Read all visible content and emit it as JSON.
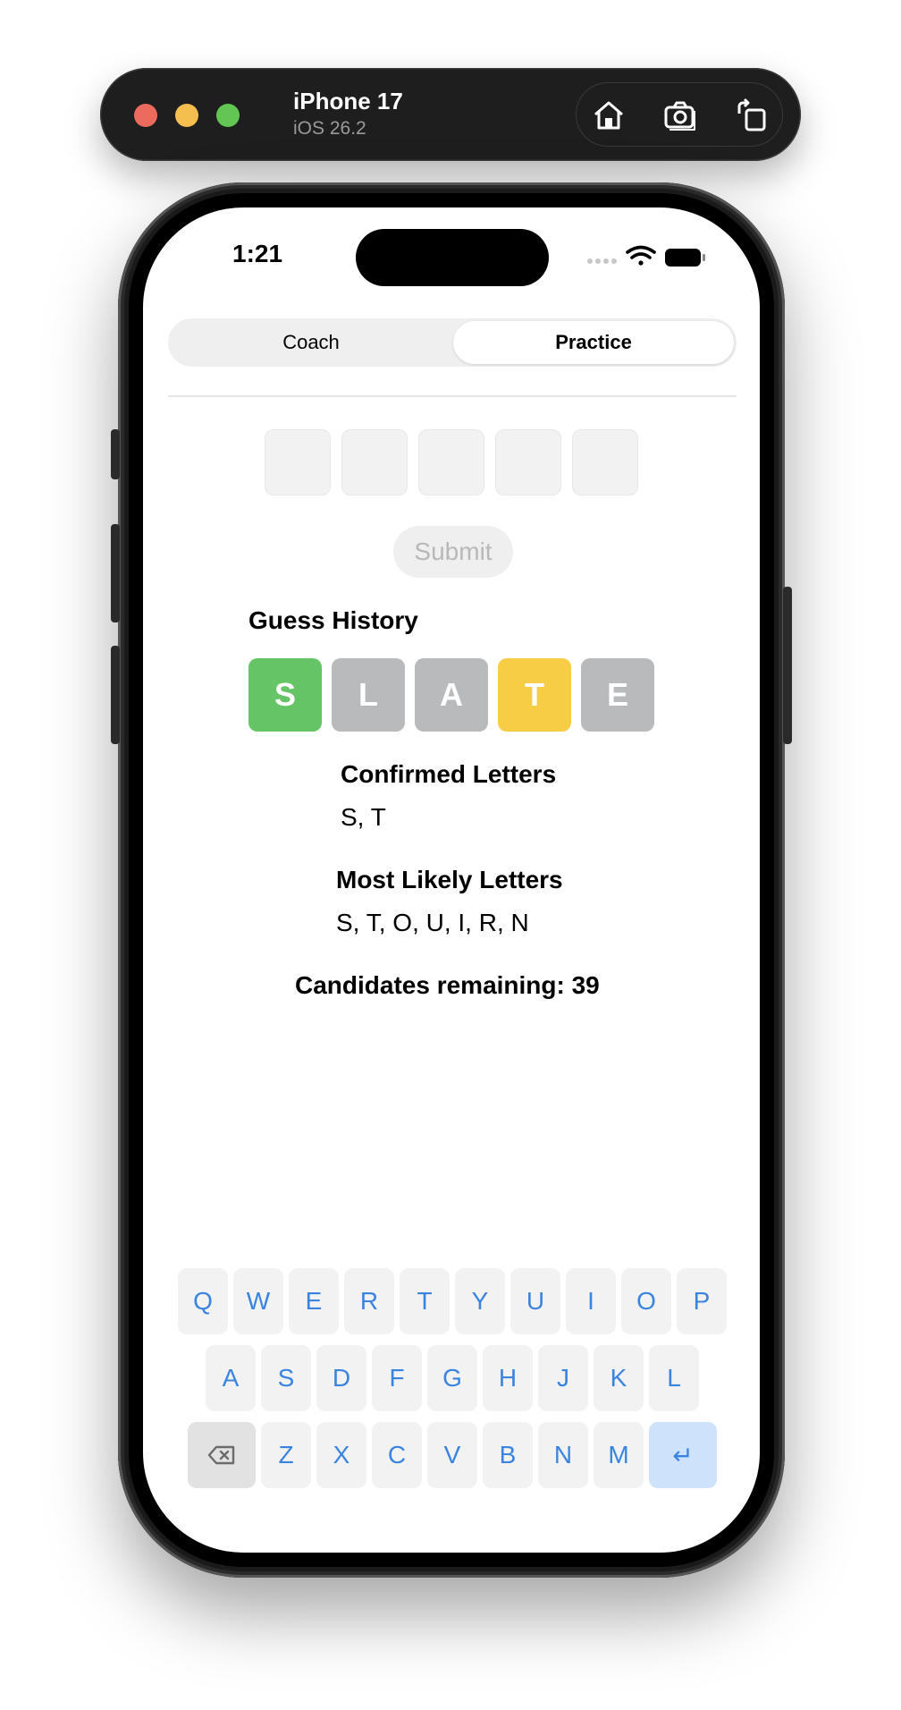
{
  "simulator": {
    "device_name": "iPhone 17",
    "os_version": "iOS 26.2"
  },
  "status_bar": {
    "time": "1:21"
  },
  "tabs": [
    {
      "label": "Coach",
      "selected": false
    },
    {
      "label": "Practice",
      "selected": true
    }
  ],
  "guess_input": {
    "letters": [
      "",
      "",
      "",
      "",
      ""
    ]
  },
  "submit": {
    "label": "Submit",
    "enabled": false
  },
  "guess_history": {
    "title": "Guess History",
    "tiles": [
      {
        "letter": "S",
        "status": "correct"
      },
      {
        "letter": "L",
        "status": "absent"
      },
      {
        "letter": "A",
        "status": "absent"
      },
      {
        "letter": "T",
        "status": "present"
      },
      {
        "letter": "E",
        "status": "absent"
      }
    ]
  },
  "confirmed_letters": {
    "title": "Confirmed Letters",
    "value": "S, T"
  },
  "likely_letters": {
    "title": "Most Likely Letters",
    "value": "S, T, O, U, I, R, N"
  },
  "candidates": {
    "label": "Candidates remaining: 39"
  },
  "keyboard": {
    "row1": [
      "Q",
      "W",
      "E",
      "R",
      "T",
      "Y",
      "U",
      "I",
      "O",
      "P"
    ],
    "row2": [
      "A",
      "S",
      "D",
      "F",
      "G",
      "H",
      "J",
      "K",
      "L"
    ],
    "row3": [
      "Z",
      "X",
      "C",
      "V",
      "B",
      "N",
      "M"
    ],
    "backspace_icon": "delete-left-icon",
    "enter_label": "↵"
  },
  "colors": {
    "correct": "#65c466",
    "present": "#f7cd46",
    "absent": "#b9babc",
    "key_text": "#3a84e0"
  }
}
